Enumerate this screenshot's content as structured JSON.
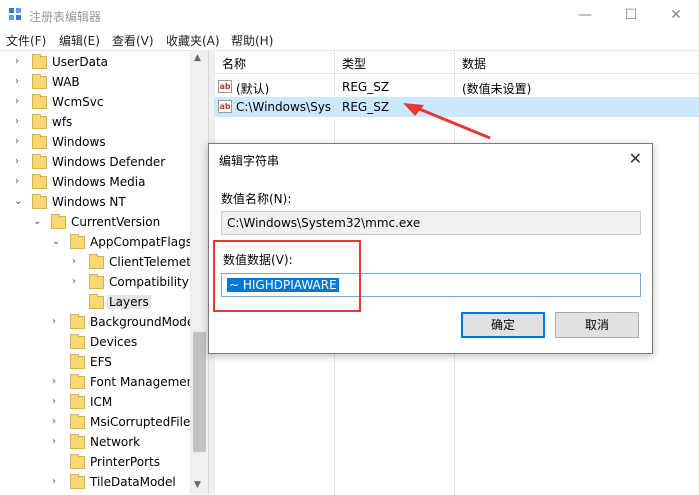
{
  "window": {
    "title": "注册表编辑器",
    "min": "—",
    "max": "☐",
    "close": "✕"
  },
  "menu": [
    "文件(F)",
    "编辑(E)",
    "查看(V)",
    "收藏夹(A)",
    "帮助(H)"
  ],
  "tree": [
    {
      "label": "UserData"
    },
    {
      "label": "WAB"
    },
    {
      "label": "WcmSvc"
    },
    {
      "label": "wfs"
    },
    {
      "label": "Windows"
    },
    {
      "label": "Windows Defender"
    },
    {
      "label": "Windows Media"
    },
    {
      "label": "Windows NT"
    },
    {
      "label": "CurrentVersion"
    },
    {
      "label": "AppCompatFlags"
    },
    {
      "label": "ClientTelemetr"
    },
    {
      "label": "Compatibility A"
    },
    {
      "label": "Layers"
    },
    {
      "label": "BackgroundMode"
    },
    {
      "label": "Devices"
    },
    {
      "label": "EFS"
    },
    {
      "label": "Font Management"
    },
    {
      "label": "ICM"
    },
    {
      "label": "MsiCorruptedFile"
    },
    {
      "label": "Network"
    },
    {
      "label": "PrinterPorts"
    },
    {
      "label": "TileDataModel"
    }
  ],
  "list": {
    "headers": {
      "name": "名称",
      "type": "类型",
      "data": "数据"
    },
    "rows": [
      {
        "icon": "ab",
        "name": "(默认)",
        "type": "REG_SZ",
        "data": "(数值未设置)"
      },
      {
        "icon": "ab",
        "name": "C:\\Windows\\Sys...",
        "type": "REG_SZ",
        "data": ""
      }
    ]
  },
  "dialog": {
    "title": "编辑字符串",
    "name_label": "数值名称(N):",
    "name_value": "C:\\Windows\\System32\\mmc.exe",
    "data_label": "数值数据(V):",
    "data_value": "~ HIGHDPIAWARE",
    "ok": "确定",
    "cancel": "取消"
  },
  "colors": {
    "annotation": "#e53935",
    "selection": "#0078d7",
    "row_selected": "#cce8ff"
  }
}
